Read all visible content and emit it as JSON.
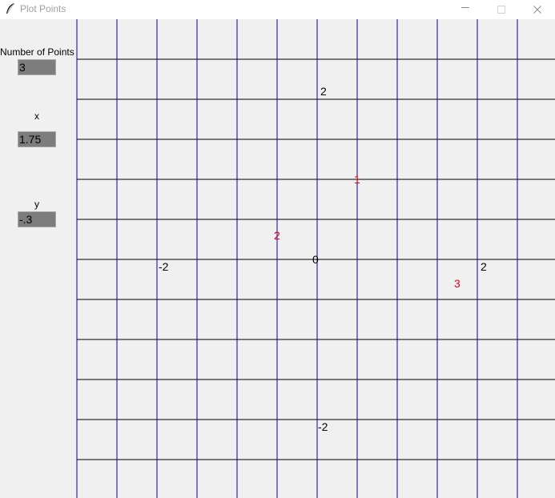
{
  "window": {
    "title": "Plot Points"
  },
  "inputs": {
    "count_label": "Number of Points",
    "count_value": "3",
    "x_label": "x",
    "x_value": "1.75",
    "y_label": "y",
    "y_value": "-.3"
  },
  "plot": {
    "origin_label": "0",
    "axis_tick_labels": {
      "x_neg": "-2",
      "x_pos": "2",
      "y_pos": "2",
      "y_neg": "-2"
    },
    "points": [
      {
        "label": "1",
        "x": 0.5,
        "y": 1.0
      },
      {
        "label": "2",
        "x": -0.5,
        "y": 0.3
      },
      {
        "label": "3",
        "x": 1.75,
        "y": -0.3
      }
    ],
    "colors": {
      "vertical_grid": "#0000aa",
      "horizontal_grid": "#000000",
      "point_label": "#e0001b"
    }
  }
}
